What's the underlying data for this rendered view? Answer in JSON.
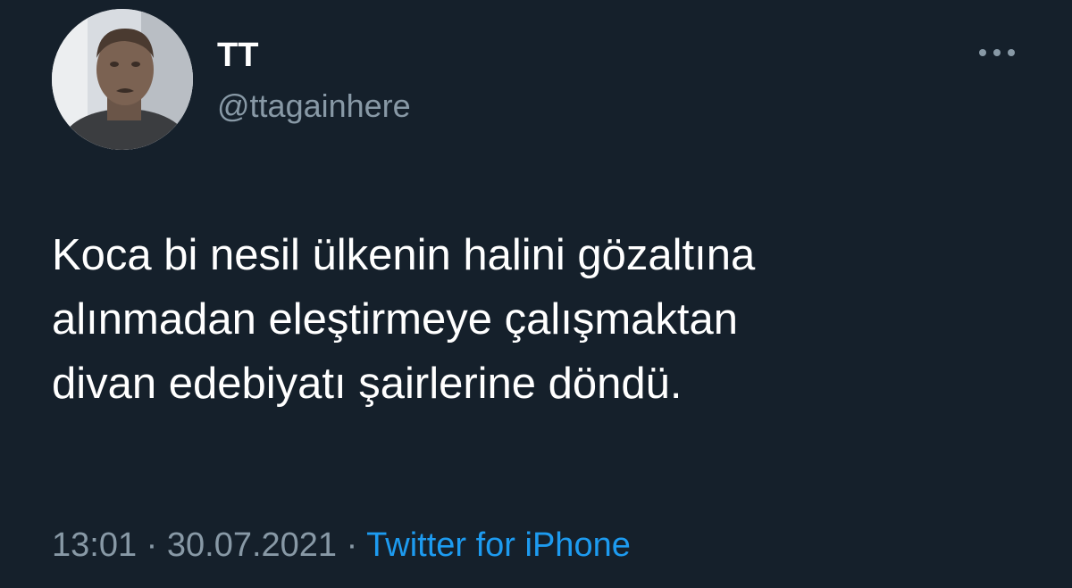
{
  "author": {
    "display_name": "TT",
    "handle": "@ttagainhere",
    "avatar_icon": "profile-photo"
  },
  "menu": {
    "icon": "more-horizontal-icon"
  },
  "tweet": {
    "lines": [
      "Koca bi nesil ülkenin halini gözaltına",
      "alınmadan eleştirmeye çalışmaktan",
      "divan edebiyatı şairlerine döndü."
    ]
  },
  "meta": {
    "time": "13:01",
    "separator": " · ",
    "date": "30.07.2021",
    "source": "Twitter for iPhone"
  },
  "colors": {
    "background": "#15202b",
    "text": "#ffffff",
    "secondary": "#8899a6",
    "link": "#1d9bf0"
  }
}
